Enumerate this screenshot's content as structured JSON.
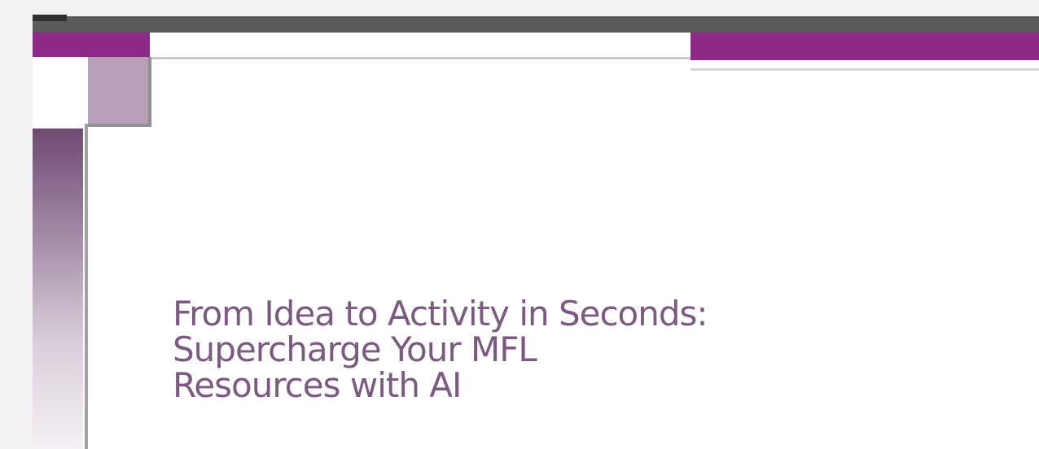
{
  "slide": {
    "title_lines": [
      "From Idea to Activity in Seconds:",
      "Supercharge Your MFL",
      "Resources with AI"
    ]
  },
  "colors": {
    "accent": "#8e2a88",
    "title_text": "#7b5a80",
    "mauve_block": "#b79fb8",
    "background": "#f1f1f1"
  }
}
